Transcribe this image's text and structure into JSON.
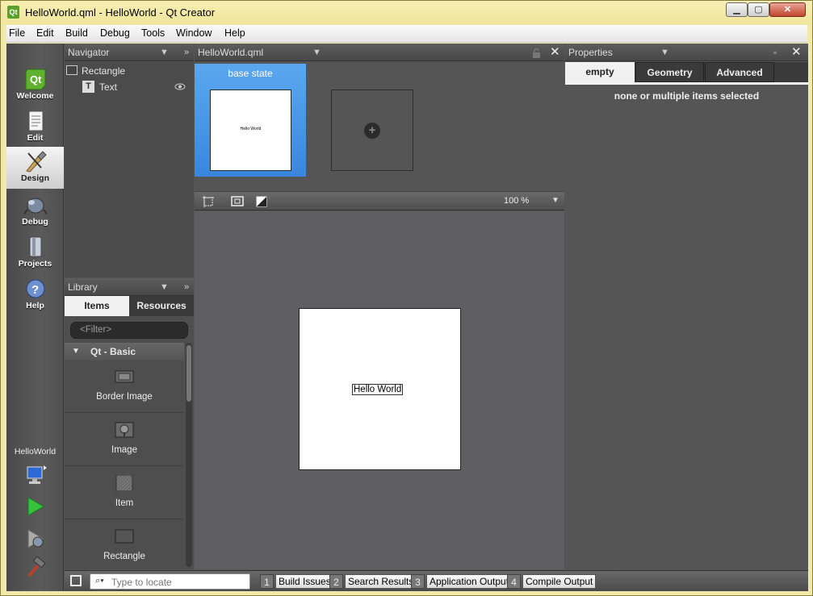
{
  "window": {
    "title": "HelloWorld.qml - HelloWorld - Qt Creator",
    "app_icon": "qt-creator-icon",
    "controls": {
      "minimize": "▁",
      "maximize": "▢",
      "close": "✕"
    }
  },
  "menubar": {
    "items": [
      "File",
      "Edit",
      "Build",
      "Debug",
      "Tools",
      "Window",
      "Help"
    ]
  },
  "modes": [
    {
      "label": "Welcome",
      "icon": "qt-logo-icon"
    },
    {
      "label": "Edit",
      "icon": "document-icon"
    },
    {
      "label": "Design",
      "icon": "design-brush-icon",
      "active": true
    },
    {
      "label": "Debug",
      "icon": "bug-icon"
    },
    {
      "label": "Projects",
      "icon": "folder-icon"
    },
    {
      "label": "Help",
      "icon": "question-icon"
    }
  ],
  "project_selector": {
    "label": "HelloWorld"
  },
  "navigator": {
    "title": "Navigator",
    "items": [
      {
        "label": "Rectangle",
        "icon": "rectangle-icon"
      },
      {
        "label": "Text",
        "icon": "text-icon",
        "visibility_icon": "eye-icon"
      }
    ]
  },
  "library": {
    "title": "Library",
    "tabs": [
      "Items",
      "Resources"
    ],
    "active_tab": "Items",
    "filter_placeholder": "<Filter>",
    "category": "Qt - Basic",
    "items": [
      {
        "label": "Border Image",
        "icon": "border-image-icon"
      },
      {
        "label": "Image",
        "icon": "image-icon"
      },
      {
        "label": "Item",
        "icon": "item-icon"
      },
      {
        "label": "Rectangle",
        "icon": "rectangle-icon"
      }
    ]
  },
  "editor": {
    "file_name": "HelloWorld.qml",
    "states": {
      "base_state_label": "base state",
      "thumbnail_text": "Hello World"
    },
    "zoom": "100 %",
    "canvas_text": "Hello World"
  },
  "properties": {
    "title": "Properties",
    "tabs": [
      "empty",
      "Geometry",
      "Advanced"
    ],
    "active_tab": "empty",
    "message": "none or multiple items selected"
  },
  "statusbar": {
    "locate_placeholder": "Type to locate",
    "panes": [
      {
        "num": "1",
        "label": "Build Issues"
      },
      {
        "num": "2",
        "label": "Search Results"
      },
      {
        "num": "3",
        "label": "Application Output"
      },
      {
        "num": "4",
        "label": "Compile Output"
      }
    ]
  }
}
